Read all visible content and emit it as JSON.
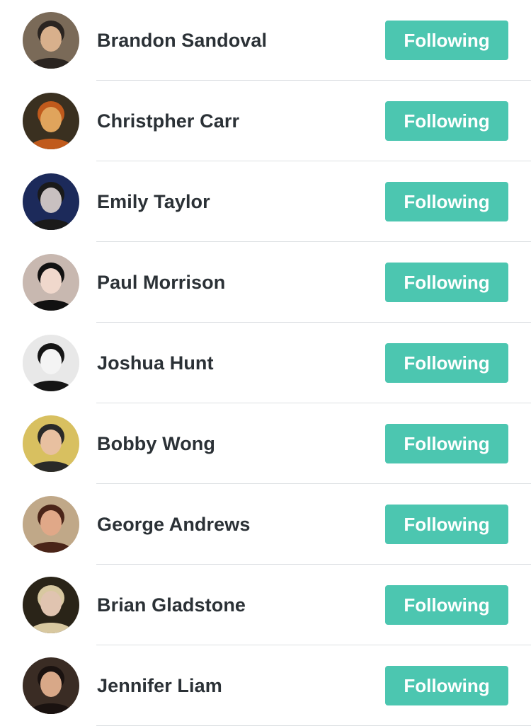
{
  "accent_color": "#4cc6b0",
  "users": [
    {
      "name": "Brandon Sandoval",
      "button_label": "Following",
      "avatar": {
        "bg": "#7a6a58",
        "skin": "#d8b08c",
        "hair": "#2a2420",
        "icon": "user-avatar-icon"
      }
    },
    {
      "name": "Christpher Carr",
      "button_label": "Following",
      "avatar": {
        "bg": "#3a3020",
        "skin": "#e0a45c",
        "hair": "#c05a1c",
        "icon": "user-avatar-icon"
      }
    },
    {
      "name": "Emily Taylor",
      "button_label": "Following",
      "avatar": {
        "bg": "#1c2a5a",
        "skin": "#c8c0c0",
        "hair": "#1a1a1a",
        "icon": "user-avatar-icon"
      }
    },
    {
      "name": "Paul Morrison",
      "button_label": "Following",
      "avatar": {
        "bg": "#c8b8b0",
        "skin": "#f0d8cc",
        "hair": "#111111",
        "icon": "user-avatar-icon"
      }
    },
    {
      "name": "Joshua Hunt",
      "button_label": "Following",
      "avatar": {
        "bg": "#e8e8e8",
        "skin": "#f4f4f4",
        "hair": "#151515",
        "icon": "user-avatar-icon"
      }
    },
    {
      "name": "Bobby Wong",
      "button_label": "Following",
      "avatar": {
        "bg": "#d8c060",
        "skin": "#e8c0a0",
        "hair": "#2a2a28",
        "icon": "user-avatar-icon"
      }
    },
    {
      "name": "George Andrews",
      "button_label": "Following",
      "avatar": {
        "bg": "#c0a888",
        "skin": "#e0a888",
        "hair": "#4a2418",
        "icon": "user-avatar-icon"
      }
    },
    {
      "name": "Brian Gladstone",
      "button_label": "Following",
      "avatar": {
        "bg": "#2a2418",
        "skin": "#e0c4b0",
        "hair": "#d8c8a0",
        "icon": "user-avatar-icon"
      }
    },
    {
      "name": "Jennifer Liam",
      "button_label": "Following",
      "avatar": {
        "bg": "#3a2c24",
        "skin": "#d8a888",
        "hair": "#1a1210",
        "icon": "user-avatar-icon"
      }
    }
  ]
}
